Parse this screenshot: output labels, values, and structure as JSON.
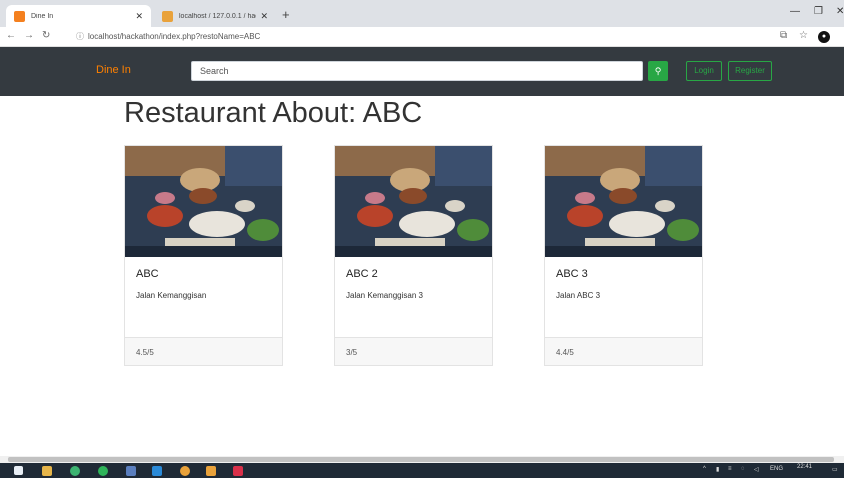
{
  "browser": {
    "tabs": [
      {
        "title": "Dine In",
        "active": true,
        "favicon_color": "#f4801f"
      },
      {
        "title": "localhost / 127.0.0.1 / hackathon",
        "active": false,
        "favicon_color": "#e9a23b"
      }
    ],
    "url": "localhost/hackathon/index.php?restoName=ABC"
  },
  "navbar": {
    "brand": "Dine In",
    "search_placeholder": "Search",
    "login_label": "Login",
    "register_label": "Register"
  },
  "main": {
    "title": "Restaurant About: ABC",
    "cards": [
      {
        "name": "ABC",
        "address": "Jalan Kemanggisan",
        "rating": "4.5/5"
      },
      {
        "name": "ABC 2",
        "address": "Jalan Kemanggisan 3",
        "rating": "3/5"
      },
      {
        "name": "ABC 3",
        "address": "Jalan ABC 3",
        "rating": "4.4/5"
      }
    ]
  },
  "taskbar": {
    "lang": "ENG",
    "time": "22:41"
  },
  "colors": {
    "navbar_bg": "#343a40",
    "brand": "#ff8000",
    "success": "#28a745"
  },
  "icons": [
    "back-icon",
    "forward-icon",
    "reload-icon",
    "info-icon",
    "translate-icon",
    "star-icon",
    "search-icon",
    "windows-start-icon"
  ]
}
